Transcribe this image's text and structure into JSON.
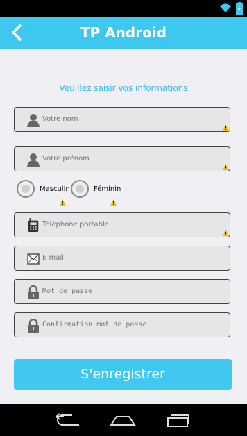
{
  "app": {
    "title": "TP Android"
  },
  "form": {
    "subtitle": "Veuillez saisir vos informations",
    "nom_placeholder": "Votre nom",
    "prenom_placeholder": "Votre prénom",
    "gender_options": [
      "Masculin",
      "Féminin"
    ],
    "phone_placeholder": "Téléphone portable",
    "email_placeholder": "E mail",
    "password_placeholder": "Mot de passe",
    "confirm_placeholder": "Confirmation mot de passe",
    "submit_label": "S'enregistrer"
  },
  "icons": {
    "back": "back-arrow-icon",
    "person": "person-icon",
    "phone": "phone-icon",
    "email": "envelope-icon",
    "lock": "lock-icon",
    "warning": "warning-icon",
    "wifi": "wifi-icon",
    "battery": "battery-icon",
    "nav_back": "nav-back-icon",
    "nav_home": "nav-home-icon",
    "nav_recent": "nav-recent-icon"
  },
  "colors": {
    "accent": "#3ec8ef",
    "subtitle": "#39b6e0",
    "background": "#f0f0f4",
    "warning": "#f5c400"
  }
}
